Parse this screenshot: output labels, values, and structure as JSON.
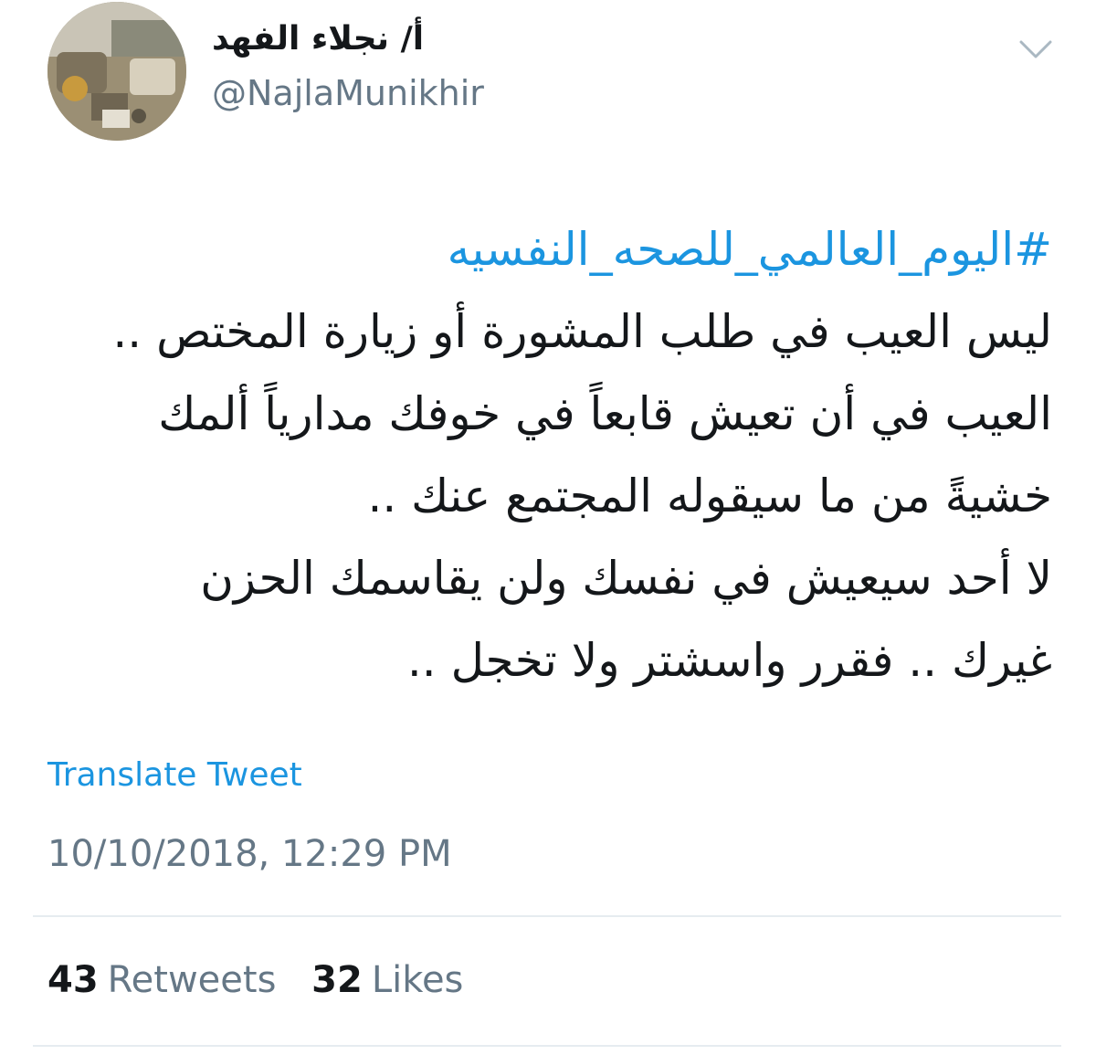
{
  "user": {
    "display_name": "أ/ نجلاء الفهد",
    "handle": "@NajlaMunikhir"
  },
  "tweet": {
    "hashtag": "#اليوم_العالمي_للصحه_النفسيه",
    "lines": [
      "ليس العيب في طلب المشورة أو زيارة المختص ..",
      "العيب في أن تعيش قابعاً في خوفك مدارياً ألمك",
      "خشيةً من ما سيقوله المجتمع عنك ..",
      "لا أحد سيعيش في نفسك ولن يقاسمك الحزن",
      "غيرك .. فقرر واسشتر ولا تخجل .."
    ],
    "translate_label": "Translate Tweet",
    "timestamp": "10/10/2018, 12:29 PM"
  },
  "stats": {
    "retweets_count": "43",
    "retweets_label": "Retweets",
    "likes_count": "32",
    "likes_label": "Likes"
  },
  "icons": {
    "menu": "chevron-down-icon"
  },
  "colors": {
    "link": "#1b95e0",
    "secondary_text": "#657786",
    "primary_text": "#14171a",
    "divider": "#e6ecf0"
  }
}
